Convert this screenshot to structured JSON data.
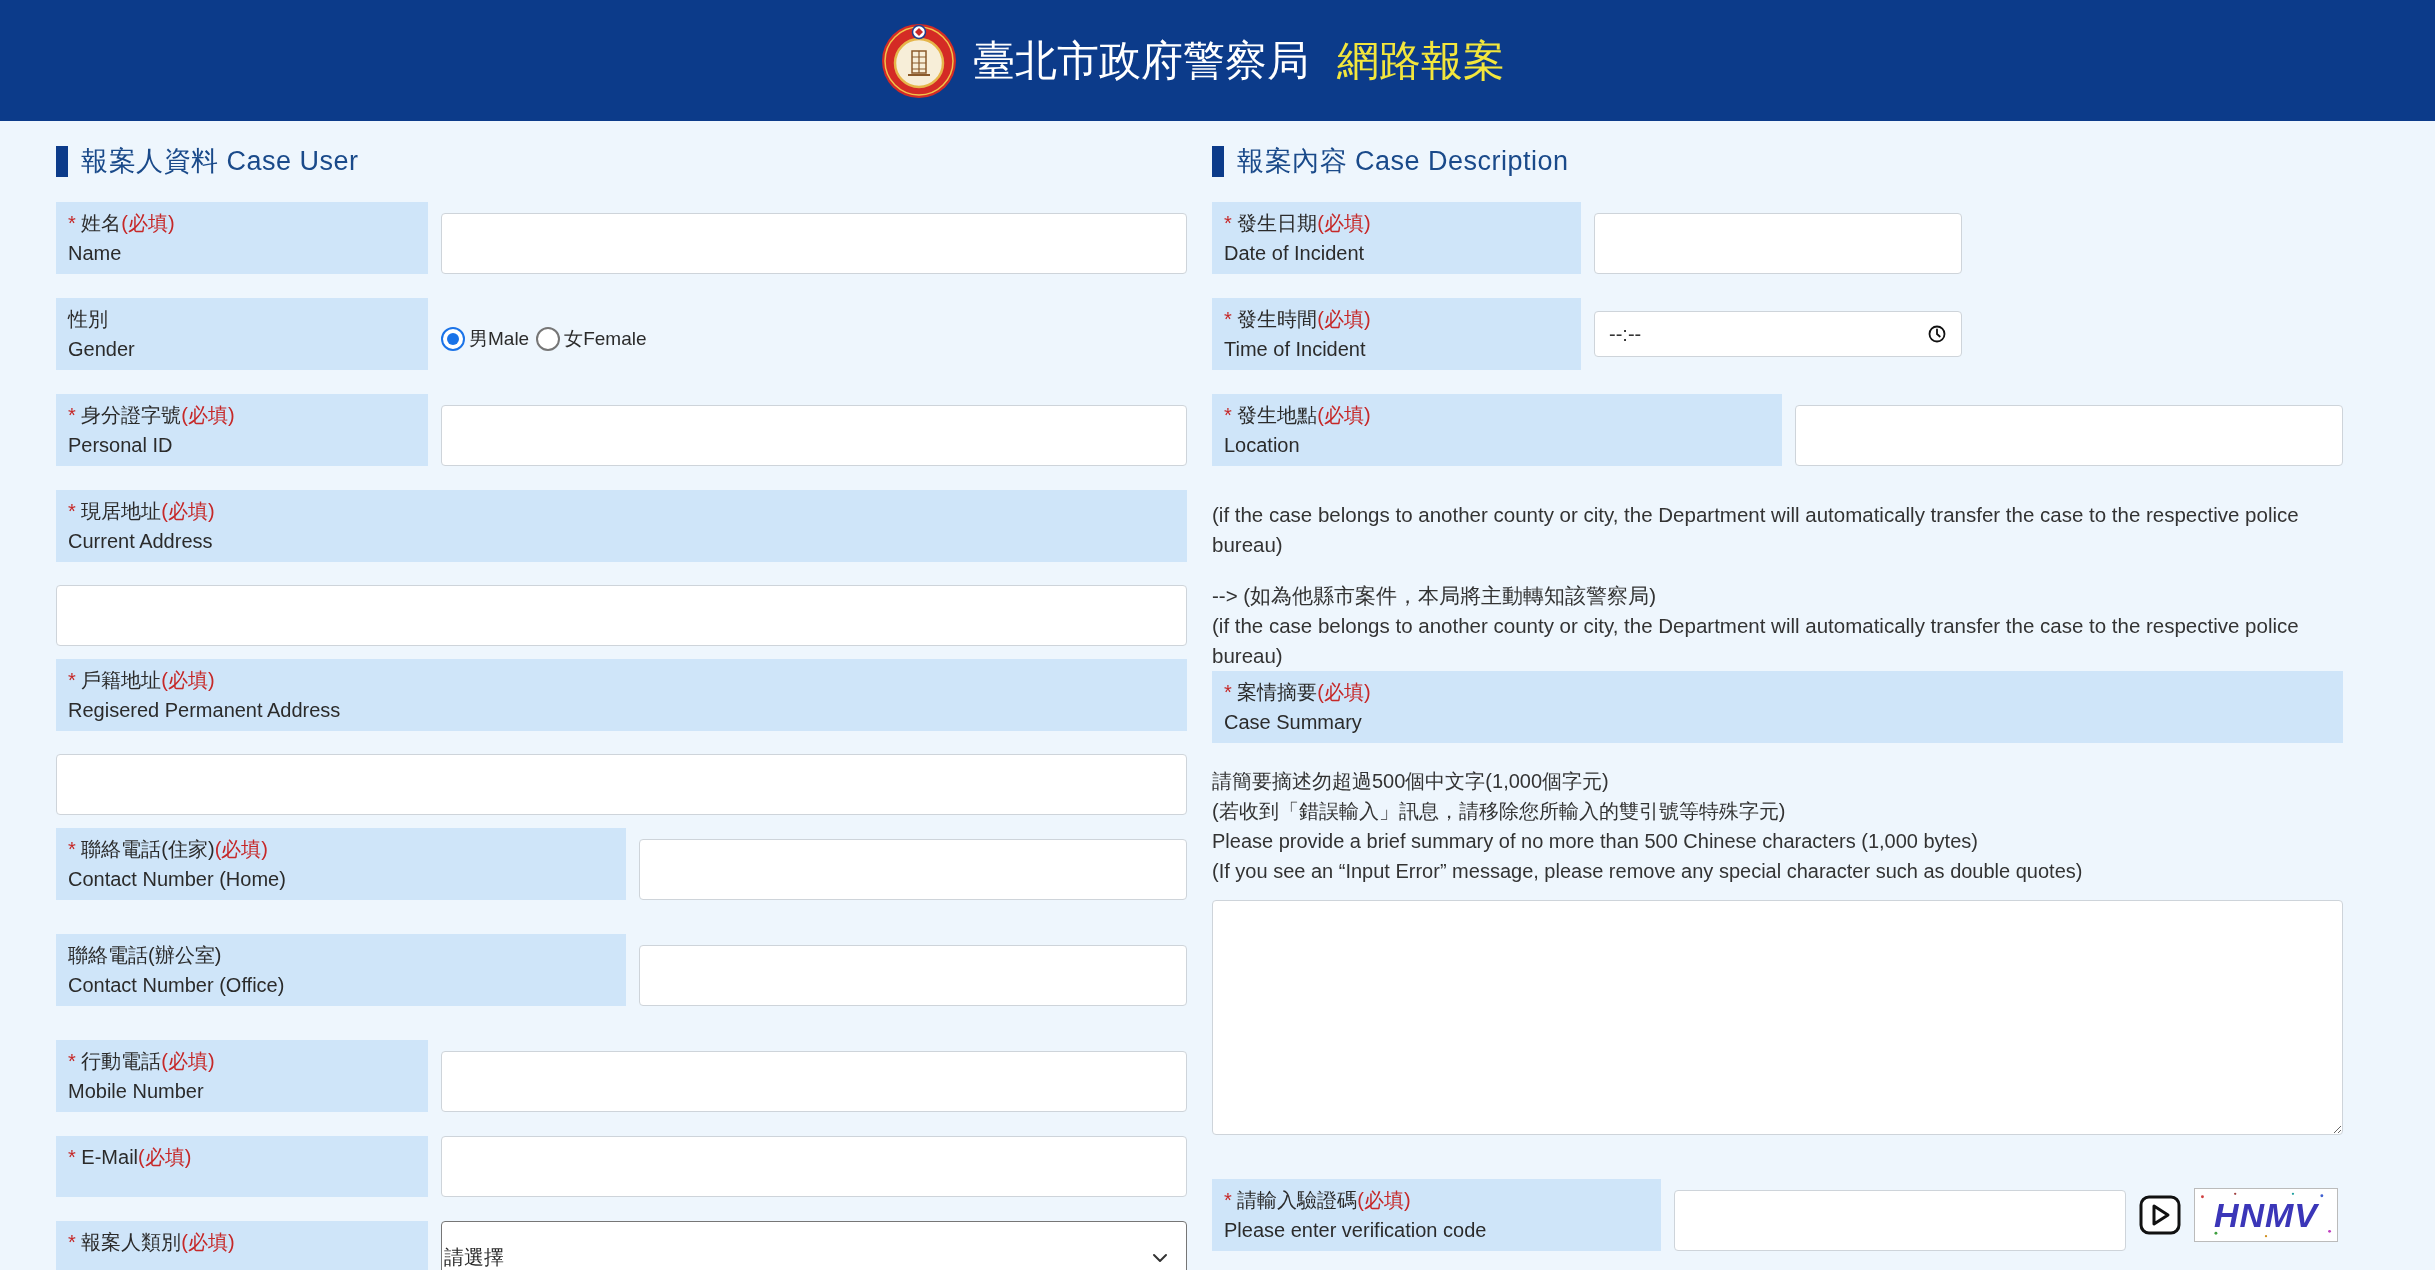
{
  "header": {
    "title": "臺北市政府警察局",
    "subtitle": "網路報案"
  },
  "reporter_section": {
    "heading": "報案人資料 Case User",
    "fields": [
      {
        "kind": "text",
        "mark": "*",
        "label_zh": "姓名",
        "note": "(必填)",
        "label_en": "Name"
      },
      {
        "kind": "radio",
        "label_zh": "性別",
        "label_en": "Gender",
        "options": [
          {
            "label": "男Male",
            "selected": true
          },
          {
            "label": "女Female",
            "selected": false
          }
        ]
      },
      {
        "kind": "text",
        "mark": "*",
        "label_zh": "身分證字號",
        "note": "(必填)",
        "label_en": "Personal ID"
      },
      {
        "kind": "block",
        "mark": "*",
        "label_zh": "現居地址",
        "note": "(必填)",
        "label_en": "Current Address"
      },
      {
        "kind": "block",
        "mark": "*",
        "label_zh": "戶籍地址",
        "note": "(必填)",
        "label_en": "Regisered Permanent Address"
      },
      {
        "kind": "wide",
        "mark": "*",
        "label_zh": "聯絡電話(住家)",
        "note": "(必填)",
        "label_en": "Contact Number (Home)"
      },
      {
        "kind": "wide",
        "label_zh": "聯絡電話(辦公室)",
        "label_en": "Contact Number (Office)"
      },
      {
        "kind": "text",
        "mark": "*",
        "label_zh": "行動電話",
        "note": "(必填)",
        "label_en": "Mobile Number"
      },
      {
        "kind": "text",
        "mark": "*",
        "label_zh": "E-Mail",
        "note": "(必填)"
      },
      {
        "kind": "select",
        "mark": "*",
        "label_zh": "報案人類別",
        "note": "(必填)",
        "value": "請選擇"
      }
    ]
  },
  "case_section": {
    "heading": "報案內容 Case Description",
    "fields": [
      {
        "kind": "short",
        "mark": "*",
        "label_zh": "發生日期",
        "note": "(必填)",
        "label_en": "Date of Incident"
      },
      {
        "kind": "time",
        "mark": "*",
        "label_zh": "發生時間",
        "note": "(必填)",
        "label_en": "Time of Incident",
        "placeholder": "--:--"
      },
      {
        "kind": "wide",
        "mark": "*",
        "label_zh": "發生地點",
        "note": "(必填)",
        "label_en": "Location"
      },
      {
        "kind": "note",
        "lines": [
          "(if the case belongs to another county or city, the Department will automatically transfer the case to the respective police bureau)"
        ]
      },
      {
        "kind": "note",
        "lines": [
          "--> (如為他縣市案件，本局將主動轉知該警察局)",
          "(if the case belongs to another county or city, the Department will automatically transfer the case to the respective police bureau)"
        ]
      },
      {
        "kind": "summary",
        "mark": "*",
        "label_zh": "案情摘要",
        "note": "(必填)",
        "label_en": "Case Summary",
        "instructions": [
          "請簡要摘述勿超過500個中文字(1,000個字元)",
          "(若收到「錯誤輸入」訊息，請移除您所輸入的雙引號等特殊字元)",
          "Please provide a brief summary of no more than 500 Chinese characters (1,000 bytes)",
          "(If you see an “Input Error” message, please remove any special character such as double quotes)"
        ]
      },
      {
        "kind": "captcha",
        "mark": "*",
        "label_zh": "請輸入驗證碼",
        "note": "(必填)",
        "label_en": "Please enter verification code",
        "image_text": "HNMV"
      }
    ]
  }
}
